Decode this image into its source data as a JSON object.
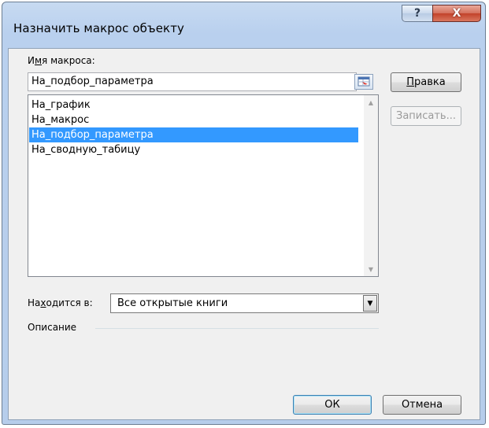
{
  "window": {
    "title": "Назначить макрос объекту",
    "help_glyph": "?",
    "close_glyph": "X"
  },
  "macro_name": {
    "label_before": "И",
    "label_underlined": "м",
    "label_after": "я макроса:",
    "value": "На_подбор_параметра"
  },
  "macro_list": {
    "items": [
      {
        "label": "На_график",
        "selected": false
      },
      {
        "label": "На_макрос",
        "selected": false
      },
      {
        "label": "На_подбор_параметра",
        "selected": true
      },
      {
        "label": "На_сводную_табицу",
        "selected": false
      }
    ]
  },
  "buttons": {
    "edit": {
      "mnemonic": "П",
      "rest": "равка"
    },
    "record": "Записать...",
    "ok": "ОК",
    "cancel": "Отмена"
  },
  "location": {
    "label_before": "На",
    "label_underlined": "х",
    "label_after": "одится в:",
    "value": "Все открытые книги"
  },
  "description": {
    "label": "Описание"
  }
}
